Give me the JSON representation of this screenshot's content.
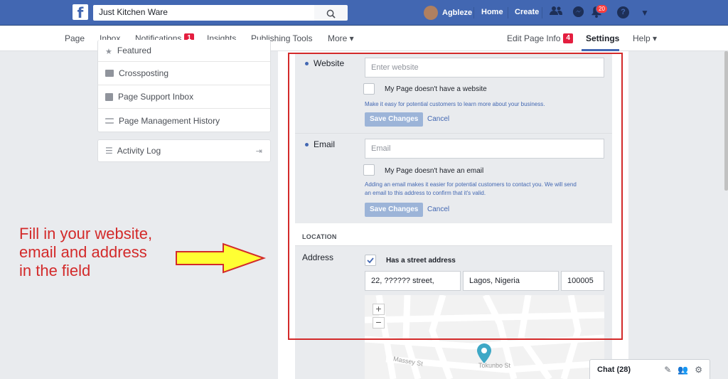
{
  "topbar": {
    "logo": "f",
    "search_value": "Just Kitchen Ware",
    "search_icon": "🔍",
    "user_name": "Agbleze",
    "home": "Home",
    "create": "Create",
    "notifications_count": "20",
    "help_icon": "?",
    "caret_icon": "▼"
  },
  "nav": {
    "page": "Page",
    "inbox": "Inbox",
    "notifications": "Notifications",
    "notifications_badge": "1",
    "insights": "Insights",
    "publishing_tools": "Publishing Tools",
    "more": "More ▾",
    "edit_page_info": "Edit Page Info",
    "edit_page_info_badge": "4",
    "settings": "Settings",
    "help": "Help ▾"
  },
  "sidebar": {
    "items": [
      {
        "label": "Featured",
        "icon": "star-icon"
      },
      {
        "label": "Crossposting",
        "icon": "video-icon"
      },
      {
        "label": "Page Support Inbox",
        "icon": "facebook-icon"
      },
      {
        "label": "Page Management History",
        "icon": "history-icon"
      }
    ],
    "activity_log": "Activity Log"
  },
  "website": {
    "label": "Website",
    "placeholder": "Enter website",
    "checkbox_label": "My Page doesn't have a website",
    "hint": "Make it easy for potential customers to learn more about your business.",
    "save": "Save Changes",
    "cancel": "Cancel"
  },
  "email": {
    "label": "Email",
    "placeholder": "Email",
    "checkbox_label": "My Page doesn't have an email",
    "hint_line1": "Adding an email makes it easier for potential customers to contact you. We will send",
    "hint_line2": "an email to this address to confirm that it's valid.",
    "save": "Save Changes",
    "cancel": "Cancel"
  },
  "location": {
    "section_title": "LOCATION",
    "address_label": "Address",
    "has_street_label": "Has a street address",
    "has_street_checked": true,
    "street": "22, ?????? street,",
    "city": "Lagos, Nigeria",
    "zip": "100005",
    "zoom_in": "+",
    "zoom_out": "−",
    "map_street1": "Massey St",
    "map_street2": "Tokunbo St"
  },
  "annotation": {
    "line1": "Fill in your website,",
    "line2": "email and address",
    "line3": "in the field"
  },
  "chat": {
    "label": "Chat (28)"
  }
}
